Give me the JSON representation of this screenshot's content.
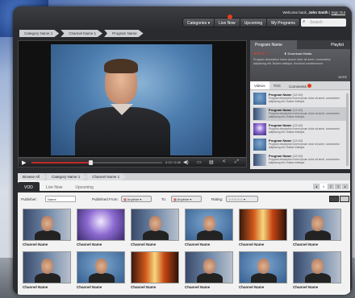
{
  "header": {
    "welcome_text": "Welcome back,",
    "user_name": "John Smith",
    "sign_out": "Sign Out",
    "nav": [
      "Categories",
      "Live Now",
      "Upcoming",
      "My Programs"
    ],
    "search_placeholder": "Search"
  },
  "breadcrumb": [
    "Category Name 1",
    "Channel Name 1",
    "Program Name"
  ],
  "player": {
    "time": "0:13 / 0:45",
    "progress": 0.45
  },
  "right_panel": {
    "tabs": [
      "Program Name",
      "Playlist"
    ],
    "rating_stars": "★★★☆☆",
    "download_label": "Download Media",
    "description": "Program description lorem ipsum dolor sit amet, consectetur adipiscing elit. Nullam tristique, tincidunt condimentum.",
    "more_label": "MORE",
    "sub_tabs": [
      "Videos",
      "TOC",
      "Comments"
    ],
    "related": [
      {
        "title": "Program Name",
        "time": "(12:40)",
        "desc": "Program description lorem ipsum dolor sit amet, consectetur adipiscing elit. Nullam tristique."
      },
      {
        "title": "Program Name",
        "time": "(12:40)",
        "desc": "Program description lorem ipsum dolor sit amet, consectetur adipiscing elit. Nullam tristique."
      },
      {
        "title": "Program Name",
        "time": "(12:40)",
        "desc": "Program description lorem ipsum dolor sit amet, consectetur adipiscing elit. Nullam tristique."
      },
      {
        "title": "Program Name",
        "time": "(12:40)",
        "desc": "Program description lorem ipsum dolor sit amet, consectetur adipiscing elit. Nullam tristique."
      },
      {
        "title": "Program Name",
        "time": "(12:40)",
        "desc": "Program description lorem ipsum dolor sit amet, consectetur adipiscing elit. Nullam tristique."
      }
    ]
  },
  "browse": {
    "breadcrumb": [
      "Browse All",
      "Category Name 1",
      "Channel Name 1"
    ],
    "tabs": [
      "VOD",
      "Live Now",
      "Upcoming"
    ],
    "pages": [
      "◂",
      "1",
      "2",
      "3",
      "▸"
    ],
    "filters": {
      "publisher_label": "Publisher:",
      "publisher_value": "Name",
      "from_label": "Published From:",
      "from_value": "Anytime",
      "to_label": "To:",
      "to_value": "Anytime",
      "rating_label": "Rating:",
      "rating_value": "☆☆☆☆☆"
    },
    "channels": [
      {
        "name": "Channel Name",
        "style": "t-people"
      },
      {
        "name": "Channel Name",
        "style": "t-purple"
      },
      {
        "name": "Channel Name",
        "style": "t-people"
      },
      {
        "name": "Channel Name",
        "style": "t-man"
      },
      {
        "name": "Channel Name",
        "style": "t-fire"
      },
      {
        "name": "Channel Name",
        "style": "t-people"
      },
      {
        "name": "Channel Name",
        "style": "t-people"
      },
      {
        "name": "Channel Name",
        "style": "t-man"
      },
      {
        "name": "Channel Name",
        "style": "t-fire"
      },
      {
        "name": "Channel Name",
        "style": "t-people"
      },
      {
        "name": "Channel Name",
        "style": "t-man"
      },
      {
        "name": "Channel Name",
        "style": "t-people"
      }
    ]
  }
}
